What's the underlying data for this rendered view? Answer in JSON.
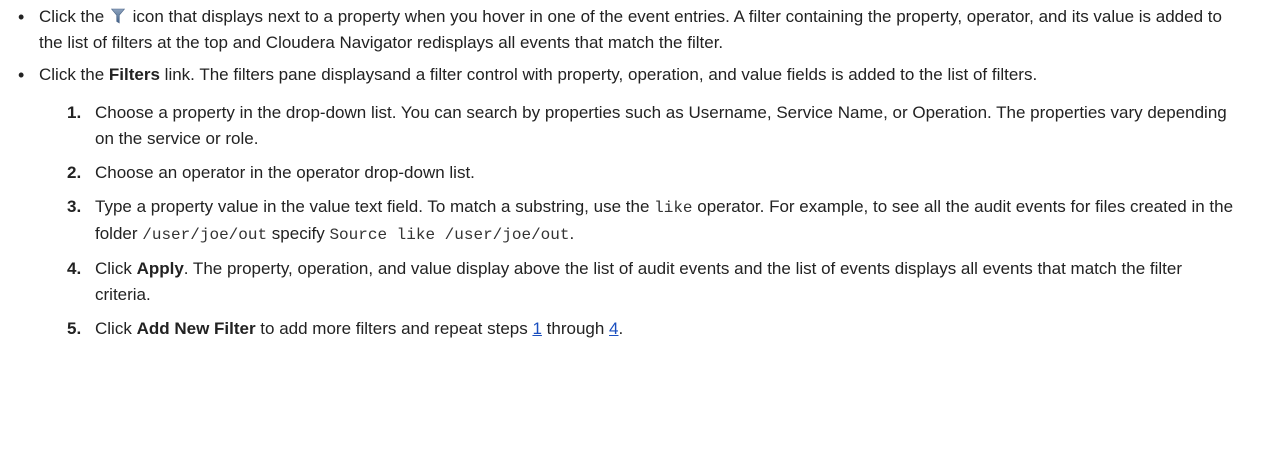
{
  "colors": {
    "text": "#222222",
    "link": "#1a4fbf",
    "filter_icon_top": "#7f95b0",
    "filter_icon_bottom": "#3f5f86"
  },
  "bullet_symbol": "•",
  "bullet1": {
    "pre": "Click the ",
    "icon": "filter-funnel-icon",
    "post": " icon that displays next to a property when you hover in one of the event entries. A filter containing the property, operator, and its value is added to the list of filters at the top and Cloudera Navigator redisplays all events that match the filter."
  },
  "bullet2": {
    "pre": "Click the ",
    "bold": "Filters",
    "post": " link. The filters pane displaysand a filter control with property, operation, and value fields is added to the list of filters."
  },
  "steps": {
    "s1": {
      "num": "1.",
      "text": "Choose a property in the drop-down list. You can search by properties such as Username, Service Name, or Operation. The properties vary depending on the service or role."
    },
    "s2": {
      "num": "2.",
      "text": "Choose an operator in the operator drop-down list."
    },
    "s3": {
      "num": "3.",
      "t1": "Type a property value in the value text field. To match a substring, use the ",
      "code1": "like",
      "t2": " operator. For example, to see all the audit events for files created in the folder ",
      "code2": "/user/joe/out",
      "t3": " specify ",
      "code3": "Source like /user/joe/out",
      "t4": "."
    },
    "s4": {
      "num": "4.",
      "t1": "Click ",
      "bold": "Apply",
      "t2": ". The property, operation, and value display above the list of audit events and the list of events displays all events that match the filter criteria."
    },
    "s5": {
      "num": "5.",
      "t1": "Click ",
      "bold": "Add New Filter",
      "t2": " to add more filters and repeat steps ",
      "link1": "1",
      "t3": " through ",
      "link2": "4",
      "t4": "."
    }
  }
}
